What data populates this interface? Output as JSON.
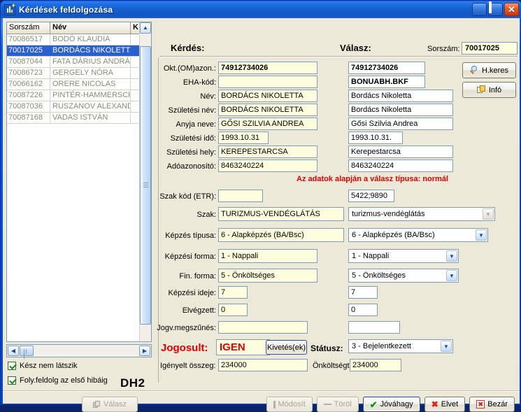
{
  "window": {
    "title": "Kérdések feldolgozása",
    "icon": "app-chart-icon",
    "minimize_label": "_",
    "maximize_label": "□",
    "close_label": "✕"
  },
  "list_panel": {
    "columns": [
      "Sorszám",
      "Név",
      "K"
    ],
    "rows": [
      {
        "sorszam": "70086517",
        "nev": "BODÓ KLAUDIA",
        "selected": false
      },
      {
        "sorszam": "70017025",
        "nev": "BORDÁCS NIKOLETTA",
        "selected": true
      },
      {
        "sorszam": "70087044",
        "nev": "FATA DÁRIUS ANDRÁS",
        "selected": false
      },
      {
        "sorszam": "70086723",
        "nev": "GERGELY NÓRA",
        "selected": false
      },
      {
        "sorszam": "70066162",
        "nev": "ORERE NICOLAS",
        "selected": false
      },
      {
        "sorszam": "70087226",
        "nev": "PINTÉR-HAMMERSCHM",
        "selected": false
      },
      {
        "sorszam": "70087036",
        "nev": "RUSZANOV ALEXANDR,",
        "selected": false
      },
      {
        "sorszam": "70087168",
        "nev": "VADAS ISTVÁN",
        "selected": false
      }
    ]
  },
  "checkboxes": [
    {
      "label": "Kész nem látszik",
      "checked": true
    },
    {
      "label": "Foly.feldolg az első hibáig",
      "checked": true
    }
  ],
  "watermark": "DH2",
  "valasz_button": {
    "label": "Válasz",
    "enabled": false
  },
  "headers": {
    "kerdes": "Kérdés:",
    "valasz": "Válasz:",
    "sorszam_label": "Sorszám:",
    "sorszam_value": "70017025"
  },
  "side_buttons": [
    {
      "label": "H.keres",
      "icon": "magnifier-icon"
    },
    {
      "label": "Infó",
      "icon": "copy-icon"
    }
  ],
  "form_rows": [
    {
      "label": "Okt.(OM)azon.:",
      "kerdes": "74912734026",
      "valasz": "74912734026",
      "bold": true
    },
    {
      "label": "EHA-kód:",
      "kerdes": "",
      "valasz": "BONUABH.BKF",
      "bold": true
    },
    {
      "label": "Név:",
      "kerdes": "BORDÁCS NIKOLETTA",
      "valasz": "Bordács Nikoletta",
      "bold": false
    },
    {
      "label": "Születési név:",
      "kerdes": "BORDÁCS NIKOLETTA",
      "valasz": "Bordács Nikoletta",
      "bold": false
    },
    {
      "label": "Anyja neve:",
      "kerdes": "GŐSI SZILVIA ANDREA",
      "valasz": "Gősi Szilvia Andrea",
      "bold": false
    },
    {
      "label": "Születési idő:",
      "kerdes": "1993.10.31",
      "valasz": "1993.10.31.",
      "bold": false
    },
    {
      "label": "Születési hely:",
      "kerdes": "KEREPESTARCSA",
      "valasz": "Kerepestarcsa",
      "bold": false
    },
    {
      "label": "Adóazonosító:",
      "kerdes": "8463240224",
      "valasz": "8463240224",
      "bold": false
    }
  ],
  "warning": "Az adatok alapján a válasz típusa: normál",
  "form_rows2": [
    {
      "label": "Szak kód (ETR):",
      "kerdes": "",
      "valasz": "5422;9890"
    }
  ],
  "combo_rows": [
    {
      "label": "Szak:",
      "kerdes": "TURIZMUS-VENDÉGLÁTÁS",
      "valasz": "turizmus-vendéglátás",
      "arrow": "dim"
    },
    {
      "label": "Képzés típusa:",
      "kerdes": "6 - Alapképzés (BA/Bsc)",
      "valasz": "6 - Alapképzés (BA/Bsc)",
      "arrow": "active"
    },
    {
      "label": "Képzési forma:",
      "kerdes": "1 - Nappali",
      "valasz": "1 - Nappali",
      "arrow": "active"
    },
    {
      "label": "Fin. forma:",
      "kerdes": "5 - Önköltséges",
      "valasz": "5 - Önköltséges",
      "arrow": "active"
    }
  ],
  "small_rows": [
    {
      "label": "Képzési ideje:",
      "kerdes": "7",
      "valasz": "7"
    },
    {
      "label": "Elvégzett:",
      "kerdes": "0",
      "valasz": "0"
    }
  ],
  "jogv_row": {
    "label": "Jogv.megszűnés:",
    "kerdes": "",
    "valasz": ""
  },
  "jogosult": {
    "label": "Jogosult:",
    "value": "IGEN",
    "kivetes_button": "Kivetés(ek)",
    "statusz_label": "Státusz:",
    "statusz_value": "3 - Bejelentkezett"
  },
  "amounts": {
    "igenyelt_label": "Igényelt összeg:",
    "igenyelt_value": "234000",
    "onkoltseg_label": "Önköltségt:",
    "onkoltseg_value": "234000"
  },
  "action_buttons": [
    {
      "label": "Módosít",
      "icon": "bar-icon",
      "enabled": false
    },
    {
      "label": "Töröl",
      "icon": "dash-icon",
      "enabled": false
    },
    {
      "label": "Jóváhagy",
      "icon": "check-icon",
      "enabled": true,
      "default": true
    },
    {
      "label": "Elvet",
      "icon": "x-icon",
      "enabled": true,
      "default": false
    },
    {
      "label": "Bezár",
      "icon": "close-box-icon",
      "enabled": true,
      "default": false
    }
  ],
  "colors": {
    "accent_red": "#e00000",
    "selection_blue": "#2a5fd0",
    "field_yellow": "#ffffdf",
    "window_face": "#ece9d8"
  }
}
